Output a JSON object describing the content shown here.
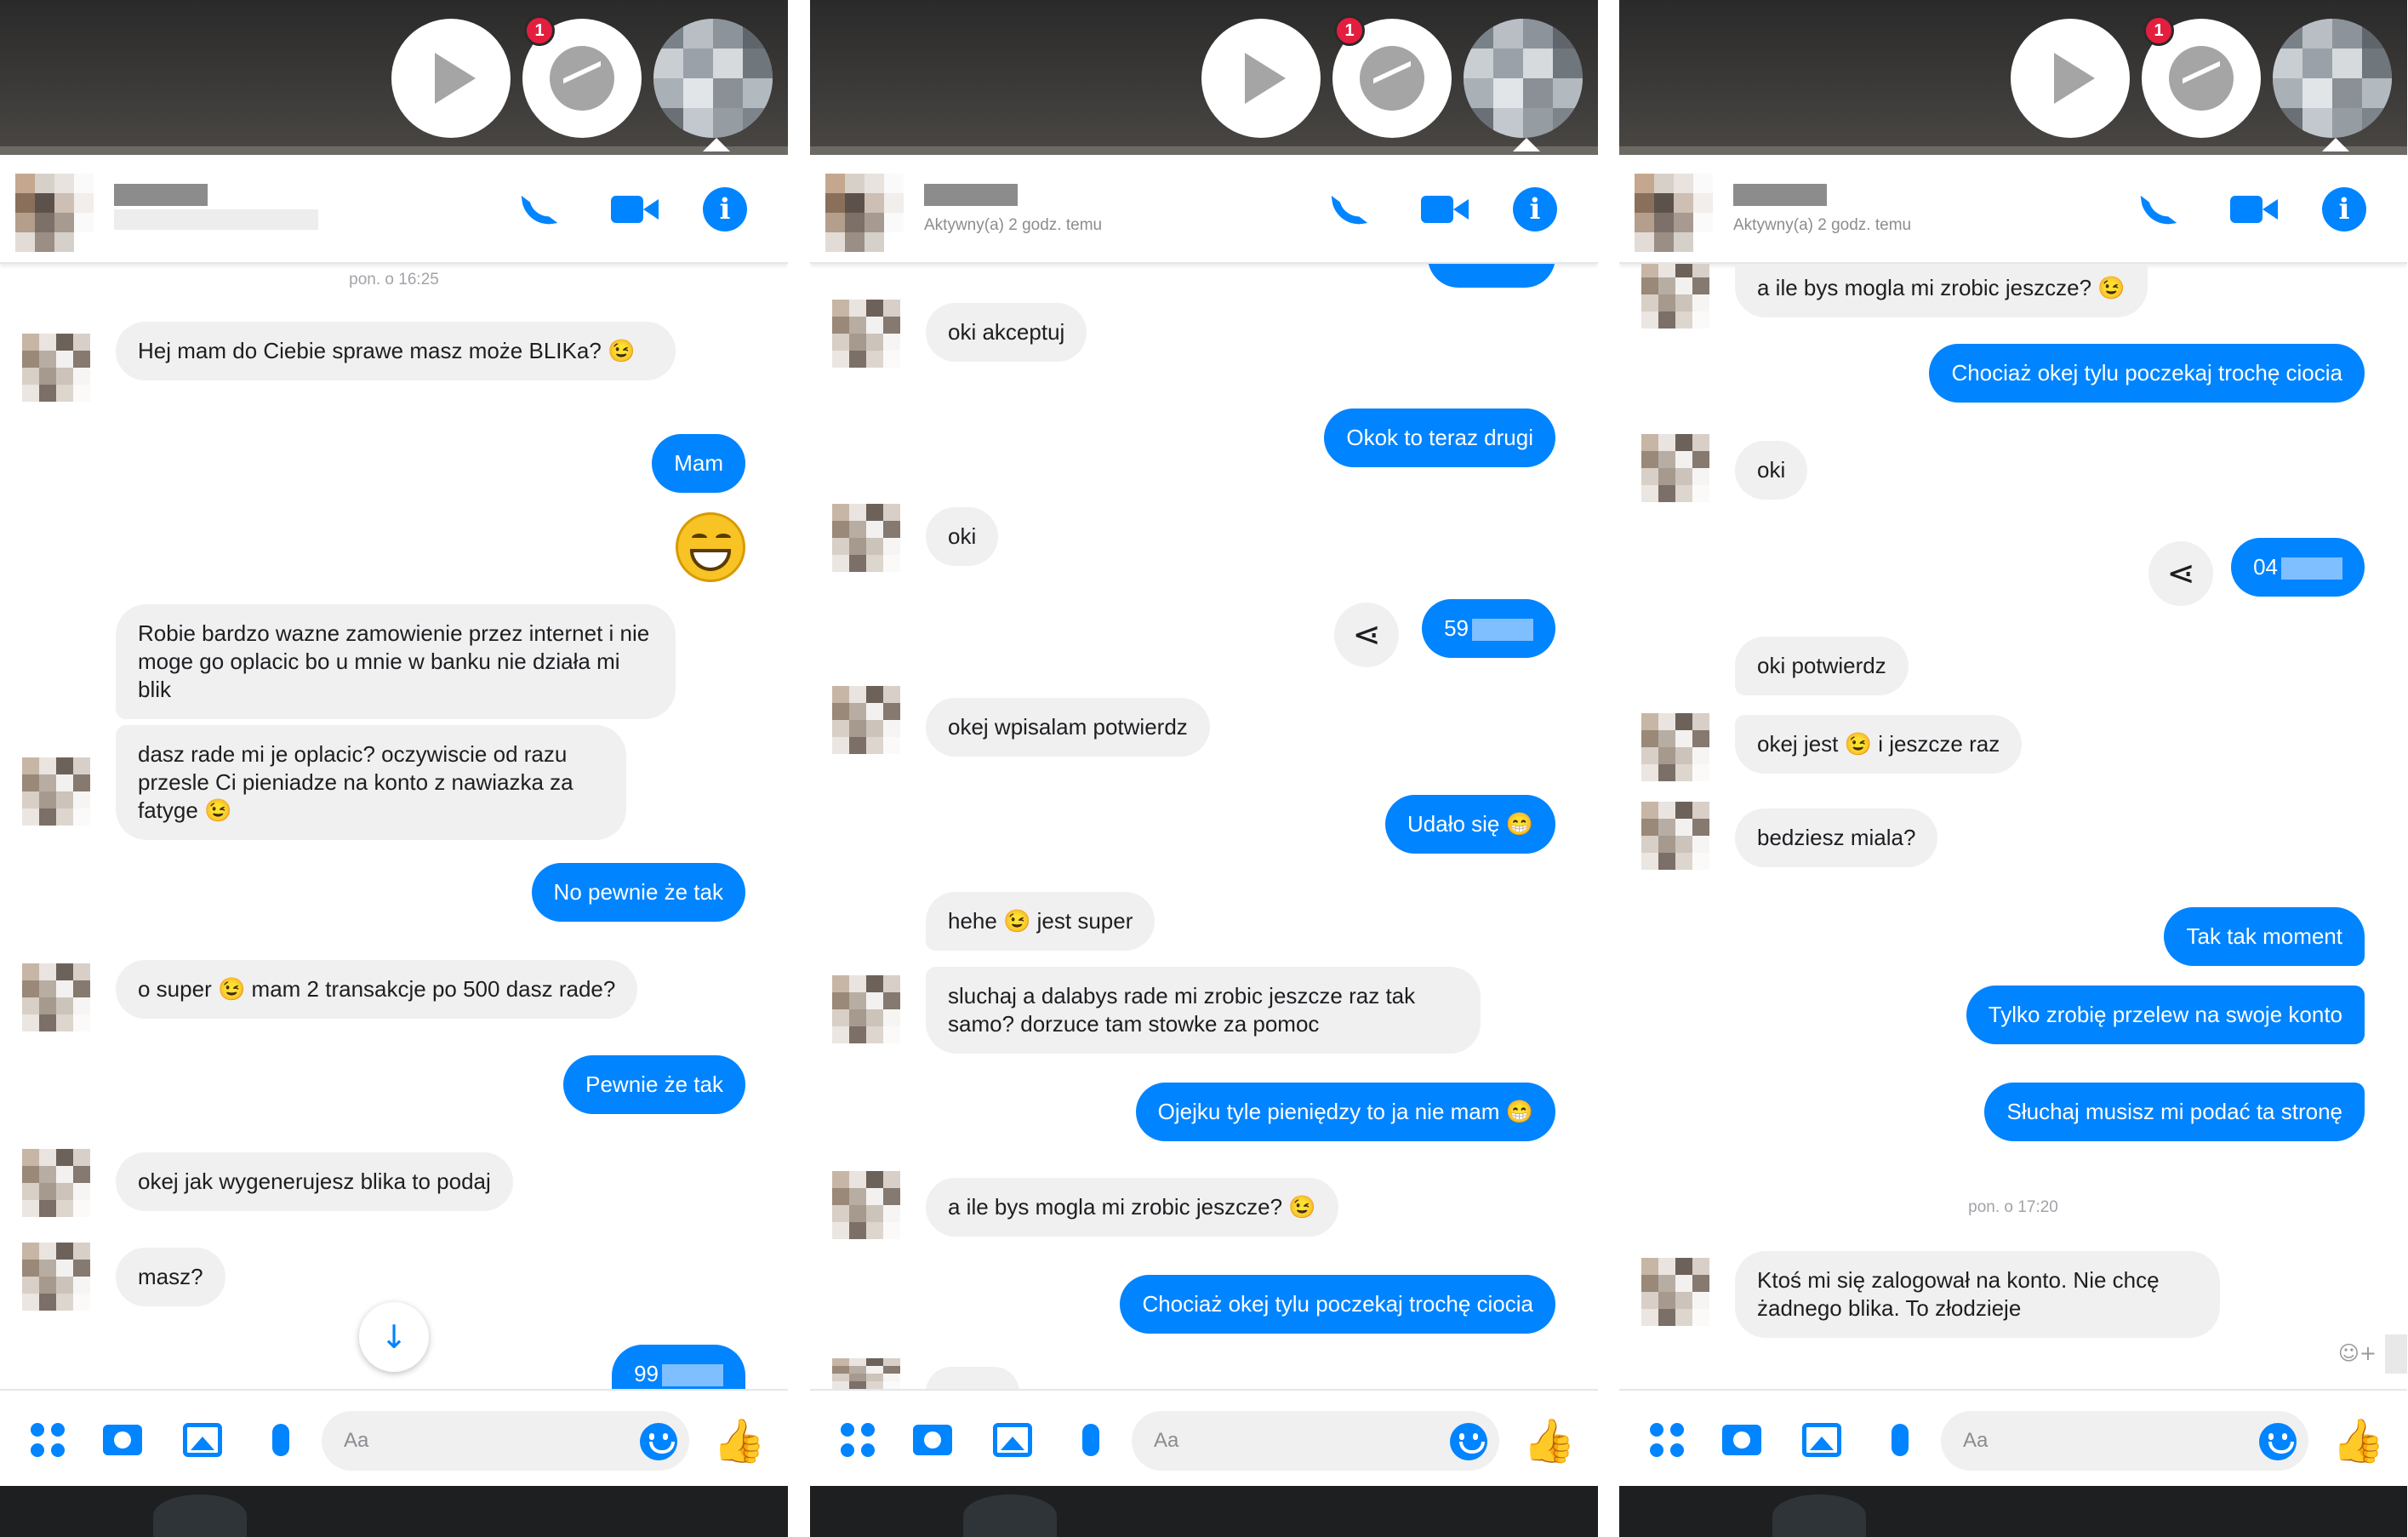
{
  "placeholder": "Aa",
  "screens": [
    {
      "header": {
        "status": ""
      },
      "timestamp_top": "pon. o 16:25",
      "messages": [
        {
          "dir": "in",
          "text": "Hej mam do Ciebie sprawe masz może BLIKa? 😉"
        },
        {
          "dir": "out",
          "text": "Mam"
        },
        {
          "dir": "in",
          "text": "Robie bardzo wazne zamowienie przez internet i nie moge go oplacic bo u mnie w banku nie działa mi blik"
        },
        {
          "dir": "in",
          "text": "dasz rade mi je oplacic? oczywiscie od razu przesle Ci pieniadze na konto z nawiazka za fatyge 😉"
        },
        {
          "dir": "out",
          "text": "No pewnie że tak"
        },
        {
          "dir": "in",
          "text": "o super 😉 mam 2 transakcje po 500 dasz rade?"
        },
        {
          "dir": "out",
          "text": "Pewnie że tak"
        },
        {
          "dir": "in",
          "text": "okej jak wygenerujesz blika to podaj"
        },
        {
          "dir": "in",
          "text": "masz?"
        },
        {
          "dir": "out",
          "text": "99"
        }
      ]
    },
    {
      "header": {
        "status": "Aktywny(a) 2 godz. temu"
      },
      "messages": [
        {
          "dir": "in",
          "text": "oki akceptuj"
        },
        {
          "dir": "out",
          "text": "Okok to teraz drugi"
        },
        {
          "dir": "in",
          "text": "oki"
        },
        {
          "dir": "out",
          "text": "59"
        },
        {
          "dir": "in",
          "text": "okej wpisalam potwierdz"
        },
        {
          "dir": "out",
          "text": "Udało się 😁"
        },
        {
          "dir": "in",
          "text": "hehe 😉 jest super"
        },
        {
          "dir": "in",
          "text": "sluchaj a dalabys rade mi zrobic jeszcze raz tak samo? dorzuce tam stowke za pomoc"
        },
        {
          "dir": "out",
          "text": "Ojejku tyle pieniędzy to ja nie mam 😁"
        },
        {
          "dir": "in",
          "text": "a ile bys mogla mi zrobic jeszcze? 😉"
        },
        {
          "dir": "out",
          "text": "Chociaż okej tylu poczekaj trochę ciocia"
        }
      ]
    },
    {
      "header": {
        "status": "Aktywny(a) 2 godz. temu"
      },
      "timestamp_mid": "pon. o 17:20",
      "messages": [
        {
          "dir": "in",
          "text": "a ile bys mogla mi zrobic jeszcze? 😉"
        },
        {
          "dir": "out",
          "text": "Chociaż okej tylu poczekaj trochę ciocia"
        },
        {
          "dir": "in",
          "text": "oki"
        },
        {
          "dir": "out",
          "text": "04"
        },
        {
          "dir": "in",
          "text": "oki potwierdz"
        },
        {
          "dir": "in",
          "text": "okej jest 😉 i jeszcze raz"
        },
        {
          "dir": "in",
          "text": "bedziesz miala?"
        },
        {
          "dir": "out",
          "text": "Tak tak moment"
        },
        {
          "dir": "out",
          "text": "Tylko zrobię przelew na swoje konto"
        },
        {
          "dir": "out",
          "text": "Słuchaj musisz mi podać ta stronę"
        },
        {
          "dir": "in",
          "text": "Ktoś mi się zalogował na konto. Nie chcę żadnego blika. To złodzieje"
        }
      ]
    }
  ],
  "badge_count": "1",
  "icons": {
    "play": "play-icon",
    "messenger": "messenger-icon",
    "call": "phone-icon",
    "video": "video-camera-icon",
    "info": "info-icon",
    "share": "share-icon",
    "more": "grid-dots-icon",
    "camera": "camera-icon",
    "gallery": "gallery-icon",
    "mic": "microphone-icon",
    "emoji": "emoji-icon",
    "like": "thumbs-up-icon",
    "scroll": "arrow-down-icon",
    "react": "add-reaction-icon"
  },
  "colors": {
    "accent": "#0084ff",
    "incoming_bubble": "#f1f0f0",
    "badge": "#e41e3f"
  }
}
